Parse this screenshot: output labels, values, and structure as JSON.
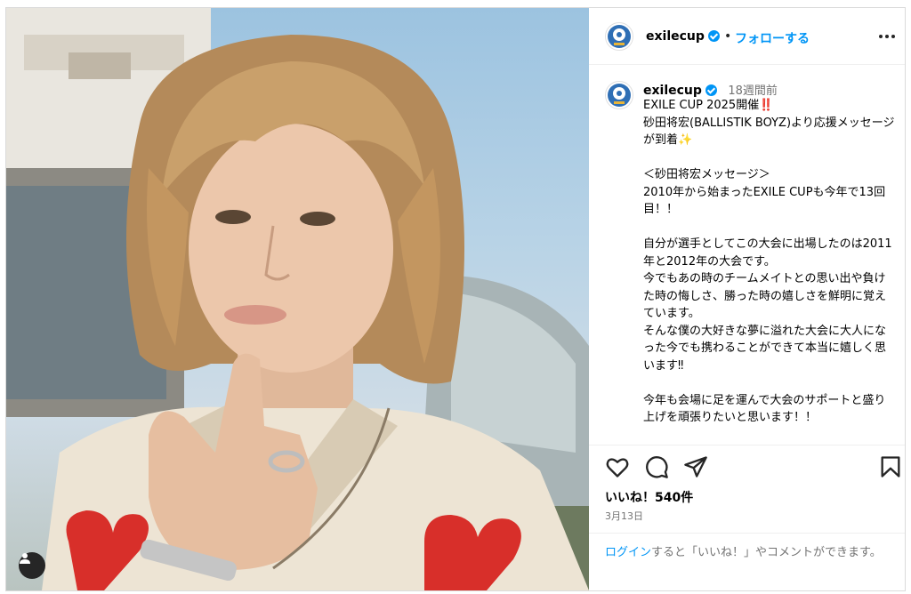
{
  "post": {
    "username": "exilecup",
    "follow_label": "フォローする",
    "dot": "•",
    "more_icon": "more-horizontal-icon",
    "caption_time": "18週間前",
    "caption": "EXILE CUP 2025開催‼️\n砂田将宏(BALLISTIK BOYZ)より応援メッセージが到着✨\n\n＜砂田将宏メッセージ＞\n2010年から始まったEXILE CUPも今年で13回目！！\n\n自分が選手としてこの大会に出場したのは2011年と2012年の大会です。\n今でもあの時のチームメイトとの思い出や負けた時の悔しさ、勝った時の嬉しさを鮮明に覚えています。\nそんな僕の大好きな夢に溢れた大会に大人になった今でも携わることができて本当に嬉しく思います‼︎\n\n今年も会場に足を運んで大会のサポートと盛り上げを頑張りたいと思います！！",
    "likes": "いいね！540件",
    "date": "3月13日",
    "login_link": "ログイン",
    "login_rest": "すると「いいね！」やコメントができます。"
  },
  "icons": {
    "like": "heart-icon",
    "comment": "comment-icon",
    "share": "send-icon",
    "save": "bookmark-icon",
    "user_tag": "user-tag-icon",
    "verified": "verified-badge-icon"
  },
  "colors": {
    "link_blue": "#0095f6",
    "secondary_text": "#737373",
    "border": "#dbdbdb"
  }
}
